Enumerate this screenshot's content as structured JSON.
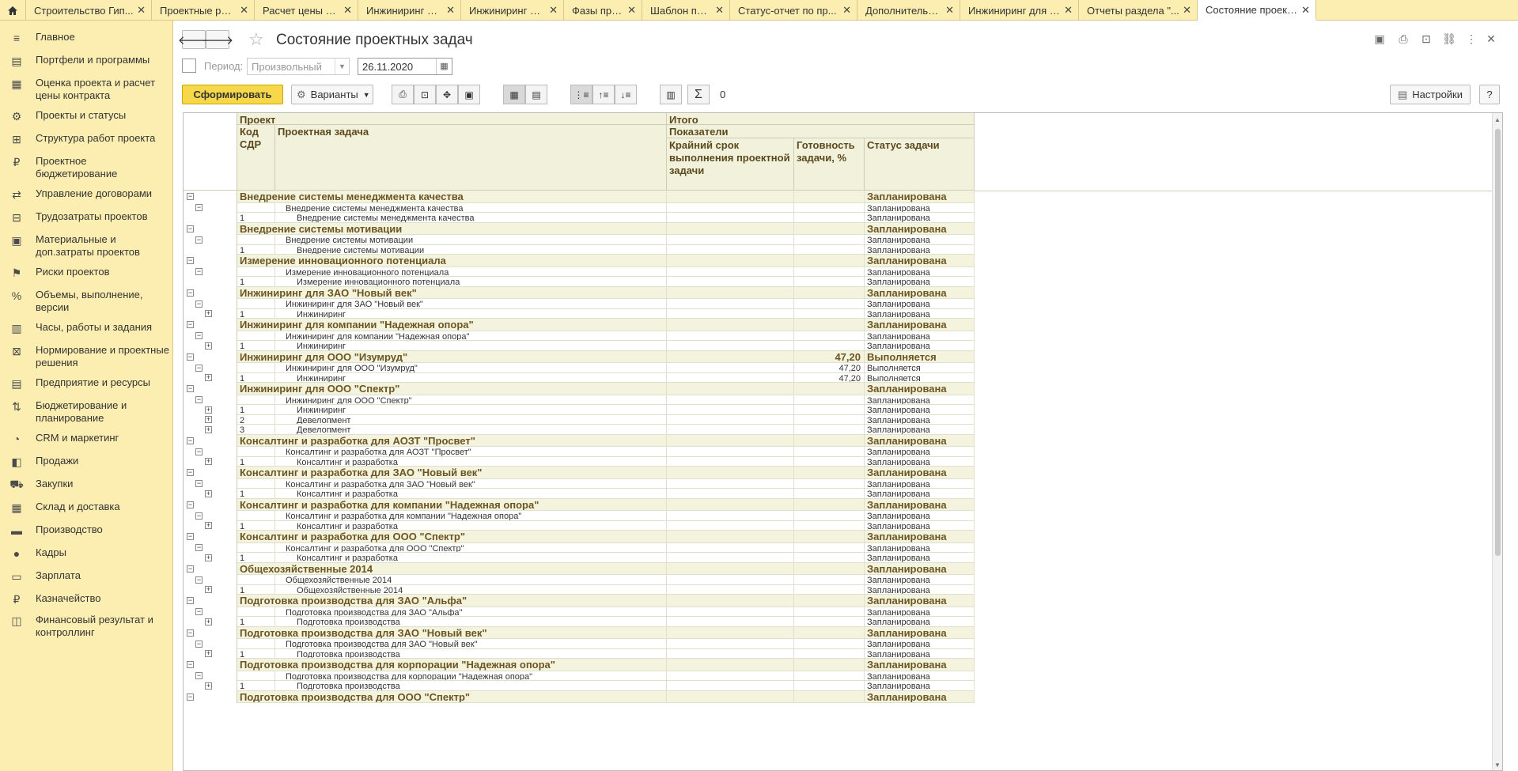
{
  "tabs": [
    {
      "label": "Строительство Гип...",
      "width": 159
    },
    {
      "label": "Проектные решен...",
      "width": 130
    },
    {
      "label": "Расчет цены контр...",
      "width": 131
    },
    {
      "label": "Инжиниринг для О...",
      "width": 130
    },
    {
      "label": "Инжиниринг для О...",
      "width": 130
    },
    {
      "label": "Фазы проектов",
      "width": 99
    },
    {
      "label": "Шаблон проекта:",
      "width": 111
    },
    {
      "label": "Статус-отчет по пр...",
      "width": 161
    },
    {
      "label": "Дополнительные о...",
      "width": 130
    },
    {
      "label": "Инжиниринг для О...",
      "width": 150
    },
    {
      "label": "Отчеты раздела \"...",
      "width": 150
    },
    {
      "label": "Состояние проект...",
      "width": 150,
      "active": true
    }
  ],
  "sidebar": [
    {
      "label": "Главное",
      "icon": "≡"
    },
    {
      "label": "Портфели и программы",
      "icon": "▤"
    },
    {
      "label": "Оценка проекта и расчет цены контракта",
      "icon": "▦"
    },
    {
      "label": "Проекты и статусы",
      "icon": "⚙"
    },
    {
      "label": "Структура работ проекта",
      "icon": "⊞"
    },
    {
      "label": "Проектное бюджетирование",
      "icon": "₽"
    },
    {
      "label": "Управление договорами",
      "icon": "⇄"
    },
    {
      "label": "Трудозатраты проектов",
      "icon": "⊟"
    },
    {
      "label": "Материальные и доп.затраты проектов",
      "icon": "▣"
    },
    {
      "label": "Риски проектов",
      "icon": "⚑"
    },
    {
      "label": "Объемы, выполнение, версии",
      "icon": "%"
    },
    {
      "label": "Часы, работы и задания",
      "icon": "▥"
    },
    {
      "label": "Нормирование и проектные решения",
      "icon": "⊠"
    },
    {
      "label": "Предприятие и ресурсы",
      "icon": "▤"
    },
    {
      "label": "Бюджетирование и планирование",
      "icon": "⇅"
    },
    {
      "label": "CRM и маркетинг",
      "icon": "◔"
    },
    {
      "label": "Продажи",
      "icon": "◧"
    },
    {
      "label": "Закупки",
      "icon": "⛟"
    },
    {
      "label": "Склад и доставка",
      "icon": "▦"
    },
    {
      "label": "Производство",
      "icon": "▬"
    },
    {
      "label": "Кадры",
      "icon": "●"
    },
    {
      "label": "Зарплата",
      "icon": "▭"
    },
    {
      "label": "Казначейство",
      "icon": "₽"
    },
    {
      "label": "Финансовый результат и контроллинг",
      "icon": "◫"
    }
  ],
  "header": {
    "title": "Состояние проектных задач",
    "back": "🡐",
    "forward": "🡒",
    "star": "☆"
  },
  "period": {
    "label": "Период:",
    "value": "Произвольный",
    "date": "26.11.2020"
  },
  "toolbar": {
    "generate": "Сформировать",
    "variants": "Варианты",
    "sum_count": "0",
    "settings": "Настройки",
    "help": "?"
  },
  "table_header": {
    "project": "Проект",
    "total": "Итого",
    "code": "Код СДР",
    "task": "Проектная задача",
    "indicators": "Показатели",
    "deadline": "Крайний срок выполнения проектной задачи",
    "readiness": "Готовность задачи, %",
    "status": "Статус задачи"
  },
  "groups": [
    {
      "name": "Внедрение системы менеджмента качества",
      "status": "Запланирована",
      "ready": "",
      "sub": "Внедрение системы менеджмента качества",
      "items": [
        {
          "code": "1",
          "task": "Внедрение системы менеджмента качества",
          "status": "Запланирована",
          "ready": "",
          "plus": false
        }
      ]
    },
    {
      "name": "Внедрение системы мотивации",
      "status": "Запланирована",
      "ready": "",
      "sub": "Внедрение системы мотивации",
      "items": [
        {
          "code": "1",
          "task": "Внедрение системы мотивации",
          "status": "Запланирована",
          "ready": "",
          "plus": false
        }
      ]
    },
    {
      "name": "Измерение инновационного потенциала",
      "status": "Запланирована",
      "ready": "",
      "sub": "Измерение инновационного потенциала",
      "items": [
        {
          "code": "1",
          "task": "Измерение инновационного потенциала",
          "status": "Запланирована",
          "ready": "",
          "plus": false
        }
      ]
    },
    {
      "name": "Инжиниринг для ЗАО \"Новый век\"",
      "status": "Запланирована",
      "ready": "",
      "sub": "Инжиниринг для ЗАО \"Новый век\"",
      "items": [
        {
          "code": "1",
          "task": "Инжиниринг",
          "status": "Запланирована",
          "ready": "",
          "plus": true
        }
      ]
    },
    {
      "name": "Инжиниринг для компании \"Надежная опора\"",
      "status": "Запланирована",
      "ready": "",
      "sub": "Инжиниринг для компании \"Надежная опора\"",
      "items": [
        {
          "code": "1",
          "task": "Инжиниринг",
          "status": "Запланирована",
          "ready": "",
          "plus": true
        }
      ]
    },
    {
      "name": "Инжиниринг для ООО \"Изумруд\"",
      "status": "Выполняется",
      "ready": "47,20",
      "sub": "Инжиниринг для ООО \"Изумруд\"",
      "sub_ready": "47,20",
      "sub_status": "Выполняется",
      "items": [
        {
          "code": "1",
          "task": "Инжиниринг",
          "status": "Выполняется",
          "ready": "47,20",
          "plus": true
        }
      ]
    },
    {
      "name": "Инжиниринг для ООО \"Спектр\"",
      "status": "Запланирована",
      "ready": "",
      "sub": "Инжиниринг для ООО \"Спектр\"",
      "items": [
        {
          "code": "1",
          "task": "Инжиниринг",
          "status": "Запланирована",
          "ready": "",
          "plus": true
        },
        {
          "code": "2",
          "task": "Девелопмент",
          "status": "Запланирована",
          "ready": "",
          "plus": true
        },
        {
          "code": "3",
          "task": "Девелопмент",
          "status": "Запланирована",
          "ready": "",
          "plus": true
        }
      ]
    },
    {
      "name": "Консалтинг и разработка для АОЗТ \"Просвет\"",
      "status": "Запланирована",
      "ready": "",
      "sub": "Консалтинг и разработка для АОЗТ \"Просвет\"",
      "items": [
        {
          "code": "1",
          "task": "Консалтинг и разработка",
          "status": "Запланирована",
          "ready": "",
          "plus": true
        }
      ]
    },
    {
      "name": "Консалтинг и разработка для ЗАО \"Новый век\"",
      "status": "Запланирована",
      "ready": "",
      "sub": "Консалтинг и разработка для ЗАО \"Новый век\"",
      "items": [
        {
          "code": "1",
          "task": "Консалтинг и разработка",
          "status": "Запланирована",
          "ready": "",
          "plus": true
        }
      ]
    },
    {
      "name": "Консалтинг и разработка для компании \"Надежная опора\"",
      "status": "Запланирована",
      "ready": "",
      "sub": "Консалтинг и разработка для компании \"Надежная опора\"",
      "items": [
        {
          "code": "1",
          "task": "Консалтинг и разработка",
          "status": "Запланирована",
          "ready": "",
          "plus": true
        }
      ]
    },
    {
      "name": "Консалтинг и разработка для ООО \"Спектр\"",
      "status": "Запланирована",
      "ready": "",
      "sub": "Консалтинг и разработка для ООО \"Спектр\"",
      "items": [
        {
          "code": "1",
          "task": "Консалтинг и разработка",
          "status": "Запланирована",
          "ready": "",
          "plus": true
        }
      ]
    },
    {
      "name": "Общехозяйственные 2014",
      "status": "Запланирована",
      "ready": "",
      "sub": "Общехозяйственные 2014",
      "items": [
        {
          "code": "1",
          "task": "Общехозяйственные 2014",
          "status": "Запланирована",
          "ready": "",
          "plus": true
        }
      ]
    },
    {
      "name": "Подготовка производства для ЗАО \"Альфа\"",
      "status": "Запланирована",
      "ready": "",
      "sub": "Подготовка производства для ЗАО \"Альфа\"",
      "items": [
        {
          "code": "1",
          "task": "Подготовка производства",
          "status": "Запланирована",
          "ready": "",
          "plus": true
        }
      ]
    },
    {
      "name": "Подготовка производства для ЗАО \"Новый век\"",
      "status": "Запланирована",
      "ready": "",
      "sub": "Подготовка производства для ЗАО \"Новый век\"",
      "items": [
        {
          "code": "1",
          "task": "Подготовка производства",
          "status": "Запланирована",
          "ready": "",
          "plus": true
        }
      ]
    },
    {
      "name": "Подготовка производства для корпорации \"Надежная опора\"",
      "status": "Запланирована",
      "ready": "",
      "sub": "Подготовка производства для корпорации \"Надежная опора\"",
      "items": [
        {
          "code": "1",
          "task": "Подготовка производства",
          "status": "Запланирована",
          "ready": "",
          "plus": true
        }
      ]
    },
    {
      "name": "Подготовка производства для ООО \"Спектр\"",
      "status": "Запланирована",
      "ready": "",
      "sub": "",
      "items": []
    }
  ]
}
